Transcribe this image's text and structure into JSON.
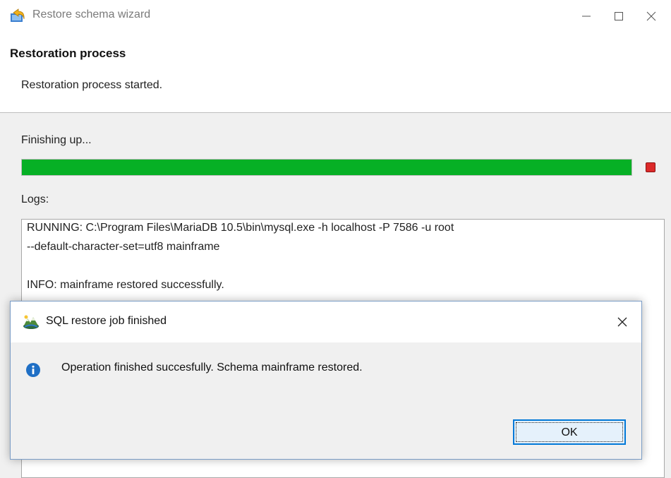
{
  "window": {
    "title": "Restore schema wizard",
    "app_icon": "restore-arrow-icon",
    "controls": [
      "minimize-icon",
      "maximize-icon",
      "close-icon"
    ]
  },
  "header": {
    "title": "Restoration process",
    "subtitle": "Restoration process started."
  },
  "progress": {
    "status": "Finishing up...",
    "fraction": 1.0,
    "color": "#06b025",
    "stop_icon": "stop-icon"
  },
  "logs": {
    "label": "Logs:",
    "lines": [
      "RUNNING: C:\\Program Files\\MariaDB 10.5\\bin\\mysql.exe -h localhost -P 7586 -u root",
      "--default-character-set=utf8 mainframe",
      "",
      "INFO: mainframe restored successfully."
    ]
  },
  "dialog": {
    "title": "SQL restore job finished",
    "icon": "database-restore-icon",
    "message_icon": "info-icon",
    "message": "Operation finished succesfully. Schema mainframe restored.",
    "ok_label": "OK",
    "accent_color": "#0078d7"
  }
}
